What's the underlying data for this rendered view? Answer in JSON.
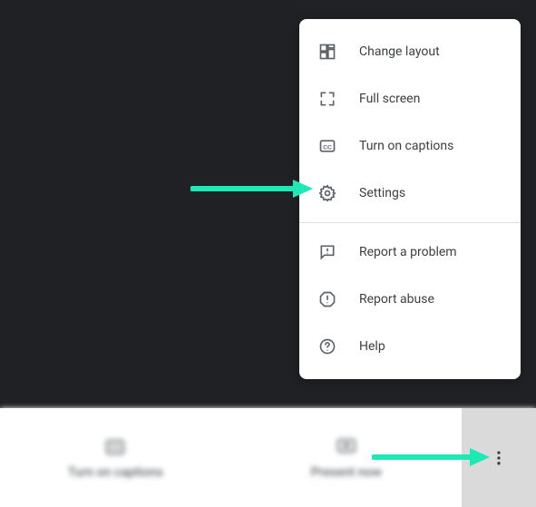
{
  "menu": {
    "items": [
      {
        "label": "Change layout"
      },
      {
        "label": "Full screen"
      },
      {
        "label": "Turn on captions"
      },
      {
        "label": "Settings"
      },
      {
        "label": "Report a problem"
      },
      {
        "label": "Report abuse"
      },
      {
        "label": "Help"
      }
    ]
  },
  "bottom": {
    "captions_label": "Turn on captions",
    "present_label": "Present now"
  },
  "colors": {
    "arrow": "#1de9b6",
    "menu_text": "#3c4043",
    "icon": "#5f6368",
    "video_bg": "#202124"
  }
}
